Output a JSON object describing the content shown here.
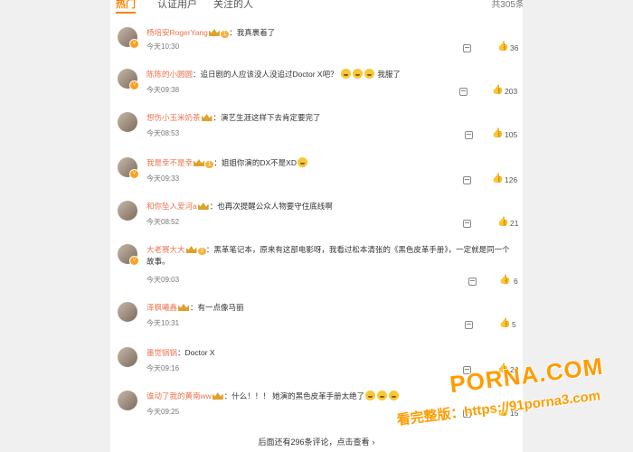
{
  "tabs": [
    {
      "label": "热门"
    },
    {
      "label": "认证用户"
    },
    {
      "label": "关注的人"
    }
  ],
  "total": "共305条",
  "comments": [
    {
      "user": "杨培安RogerYang",
      "text": "：我真裹着了",
      "time": "今天10:30",
      "likes": "36",
      "level": "1",
      "avatar": "avatar"
    },
    {
      "user": "陈陈的小圆圆",
      "text": "：追日剧的人应该没人没追过Doctor X吧？",
      "suffix": "我服了",
      "time": "今天09:38",
      "likes": "203",
      "avatar": "avatar"
    },
    {
      "user": "想伤小玉米奶茶",
      "text": "：演艺生涯这样下去肯定要完了",
      "time": "今天08:53",
      "likes": "105",
      "avatar": "avatar"
    },
    {
      "user": "我是幸不是幸",
      "text": "：姐姐你演的DX不是XD",
      "time": "今天09:33",
      "likes": "126",
      "level": "1",
      "avatar": "avatar"
    },
    {
      "user": "和你坠入爱河a",
      "text": "：也再次提醒公众人物要守住底线啊",
      "time": "今天08:52",
      "likes": "21",
      "avatar": "avatar"
    },
    {
      "user": "大老赛大大",
      "text": "：黑革笔记本，原来有这部电影呀，我看过松本清张的《黑色皮革手册》，一定就是同一个故事。",
      "time": "今天09:03",
      "likes": "6",
      "level": "2",
      "avatar": "avatar"
    },
    {
      "user": "泽枫曦鑫",
      "text": "：有一点像马丽",
      "time": "今天10:31",
      "likes": "5",
      "avatar": "avatar"
    },
    {
      "user": "墨觉锅锅",
      "text": "：Doctor X",
      "time": "今天09:16",
      "likes": "29",
      "avatar": "avatar"
    },
    {
      "user": "谁动了我的黄南ww",
      "text": "：什么！！！ 她演的黑色皮革手册太绝了",
      "time": "今天09:25",
      "likes": "15",
      "avatar": "avatar"
    }
  ],
  "more_text": "后面还有296条评论，点击查看",
  "watermark": {
    "logo": "PORNA.COM",
    "url": "看完整版：https://91porna3.com"
  },
  "colors": {
    "accent": "#ff8200",
    "username": "#eb7350",
    "watermark": "#ff9c00"
  }
}
